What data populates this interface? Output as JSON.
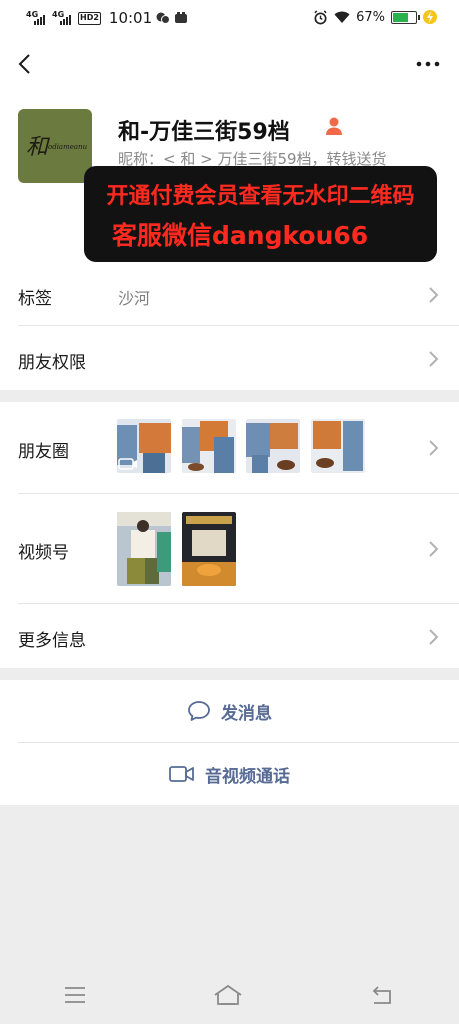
{
  "status_bar": {
    "signal_1": "4G",
    "signal_2": "4G",
    "hd": "HD2",
    "time": "10:01",
    "battery_percent": "67%",
    "battery_level": 0.67
  },
  "contact": {
    "name": "和-万佳三街59档",
    "nickname": "昵称：< 和 > 万佳三街59档，转钱送货",
    "avatar_text": "和",
    "avatar_subtext": "odiameanu"
  },
  "promo": {
    "line1": "开通付费会员查看无水印二维码",
    "line2": "客服微信dangkou66"
  },
  "rows": {
    "tags_label": "标签",
    "tags_value": "沙河",
    "permissions_label": "朋友权限",
    "moments_label": "朋友圈",
    "channels_label": "视频号",
    "more_label": "更多信息"
  },
  "actions": {
    "message": "发消息",
    "call": "音视频通话"
  },
  "colors": {
    "link": "#576b95",
    "promo_text": "#ff2a1f",
    "person_badge": "#f06a4a"
  }
}
